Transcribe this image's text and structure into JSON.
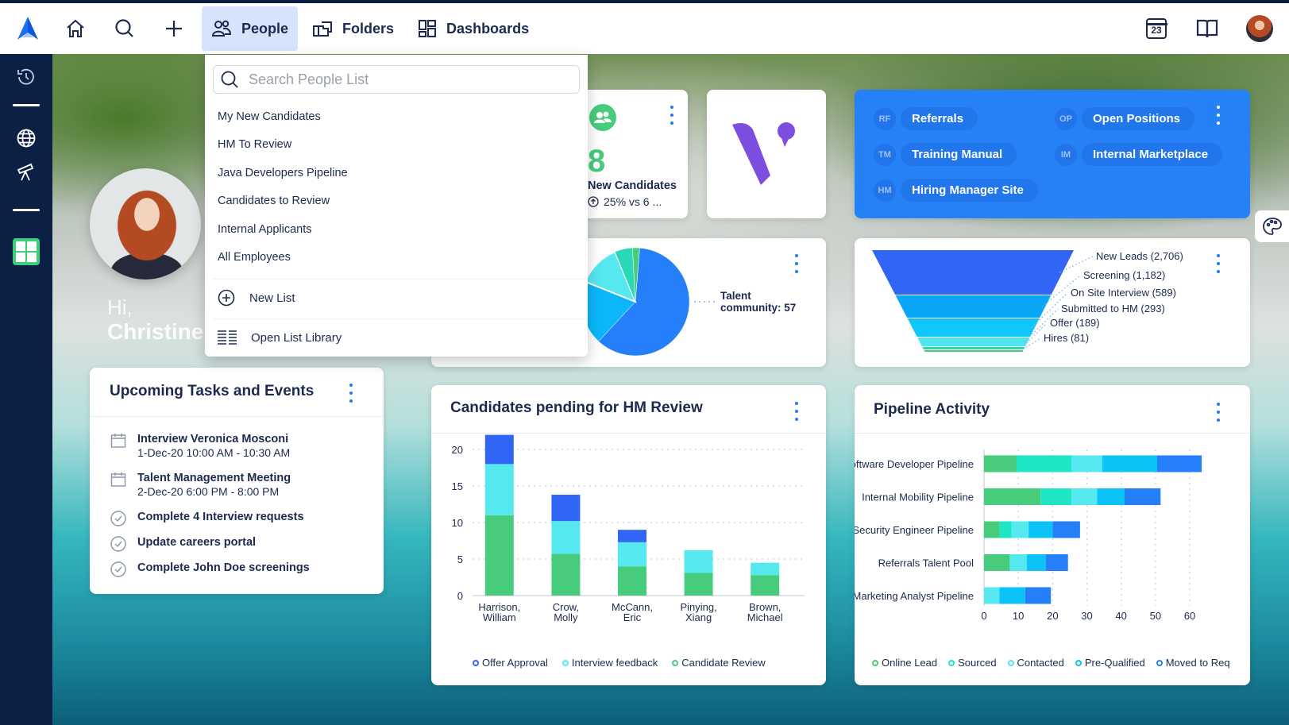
{
  "topnav": {
    "logo": "app-logo",
    "icons": {
      "home": "home-icon",
      "search": "search-icon",
      "create": "plus-icon"
    },
    "tabs": [
      {
        "label": "People",
        "icon": "people-icon",
        "active": true
      },
      {
        "label": "Folders",
        "icon": "folders-icon",
        "active": false
      },
      {
        "label": "Dashboards",
        "icon": "dashboards-icon",
        "active": false
      }
    ],
    "calendar_day": "23",
    "right_icons": [
      "calendar-icon",
      "book-icon",
      "user-avatar"
    ]
  },
  "sidebar": {
    "items": [
      "history-icon",
      "globe-icon",
      "telescope-icon",
      "dashboard-icon"
    ]
  },
  "people_dropdown": {
    "search_placeholder": "Search People List",
    "lists": [
      "My New Candidates",
      "HM To Review",
      "Java Developers Pipeline",
      "Candidates to Review",
      "Internal Applicants",
      "All Employees"
    ],
    "new_list_label": "New List",
    "open_library_label": "Open List Library"
  },
  "greeting": {
    "hi": "Hi,",
    "name": "Christine!"
  },
  "new_candidates_card": {
    "value": "8",
    "label": "New Candidates",
    "trend": "25% vs 6 ..."
  },
  "quick_links": [
    {
      "abbr": "RF",
      "label": "Referrals"
    },
    {
      "abbr": "OP",
      "label": "Open Positions"
    },
    {
      "abbr": "TM",
      "label": "Training Manual"
    },
    {
      "abbr": "IM",
      "label": "Internal Marketplace"
    },
    {
      "abbr": "HM",
      "label": "Hiring Manager Site"
    }
  ],
  "tasks_card": {
    "title": "Upcoming Tasks and Events",
    "items": [
      {
        "type": "event",
        "title": "Interview Veronica Mosconi",
        "time": "1-Dec-20 10:00 AM - 10:30 AM"
      },
      {
        "type": "event",
        "title": "Talent Management Meeting",
        "time": "2-Dec-20 6:00 PM - 8:00 PM"
      },
      {
        "type": "task",
        "title": "Complete 4 Interview requests"
      },
      {
        "type": "task",
        "title": "Update careers portal"
      },
      {
        "type": "task",
        "title": "Complete John Doe screenings"
      }
    ]
  },
  "colors": {
    "accent": "#1e7bf5",
    "quick_links_bg": "#2680f6",
    "green": "#47cc7c",
    "teal": "#1ee6c4",
    "light_cyan": "#55e8ef",
    "cyan": "#0bc3f7",
    "blue": "#247ff9",
    "deep_blue": "#3165f5"
  },
  "chart_data": [
    {
      "type": "pie",
      "title": "",
      "labels": [
        "Talent community",
        "Cyan segment",
        "Light cyan segment",
        "Teal segment",
        "Green segment"
      ],
      "values": [
        57,
        18,
        12,
        5,
        2
      ],
      "colors": [
        "#247ff9",
        "#0bb7f9",
        "#55e8ef",
        "#2ad8b8",
        "#47cc7c"
      ],
      "annotation": "Talent community: 57"
    },
    {
      "type": "funnel",
      "stages": [
        {
          "label": "New Leads (2,706)",
          "name": "New Leads",
          "value": 2706,
          "color": "#3165f5"
        },
        {
          "label": "Screening (1,182)",
          "name": "Screening",
          "value": 1182,
          "color": "#0aa6f6"
        },
        {
          "label": "On Site Interview (589)",
          "name": "On Site Interview",
          "value": 589,
          "color": "#0ec6f7"
        },
        {
          "label": "Submitted to HM (293)",
          "name": "Submitted to HM",
          "value": 293,
          "color": "#4fe6ee"
        },
        {
          "label": "Offer (189)",
          "name": "Offer",
          "value": 189,
          "color": "#2ed8a8"
        },
        {
          "label": "Hires (81)",
          "name": "Hires",
          "value": 81,
          "color": "#47cc7c"
        }
      ]
    },
    {
      "type": "bar",
      "stacked": true,
      "title": "Candidates pending for HM Review",
      "categories": [
        "Harrison, William",
        "Crow, Molly",
        "McCann, Eric",
        "Pinying, Xiang",
        "Brown, Michael"
      ],
      "category_lines": [
        [
          "Harrison,",
          "William"
        ],
        [
          "Crow,",
          "Molly"
        ],
        [
          "McCann,",
          "Eric"
        ],
        [
          "Pinying,",
          "Xiang"
        ],
        [
          "Brown,",
          "Michael"
        ]
      ],
      "series": [
        {
          "name": "Candidate Review",
          "color": "#47cc7c",
          "values": [
            11,
            5.7,
            4,
            3.1,
            2.8
          ]
        },
        {
          "name": "Interview feedback",
          "color": "#55e8ef",
          "values": [
            7,
            4.5,
            3.3,
            3.1,
            1.7
          ]
        },
        {
          "name": "Offer Approval",
          "color": "#3165f5",
          "values": [
            4,
            3.6,
            1.7,
            0,
            0
          ]
        }
      ],
      "legend_order": [
        "Offer Approval",
        "Interview feedback",
        "Candidate Review"
      ],
      "legend_colors": [
        "#3165f5",
        "#55e8ef",
        "#47cc7c"
      ],
      "yticks": [
        0,
        5,
        10,
        15,
        20
      ],
      "ylim": [
        0,
        22
      ],
      "grid": true,
      "legend": "bottom"
    },
    {
      "type": "bar",
      "orientation": "horizontal",
      "stacked": true,
      "title": "Pipeline Activity",
      "categories": [
        "Software Developer Pipeline",
        "Internal Mobility Pipeline",
        "Security Engineer Pipeline",
        "Referrals Talent Pool",
        "Marketing Analyst Pipeline"
      ],
      "series": [
        {
          "name": "Online Lead",
          "color": "#47cc7c",
          "values": [
            9.5,
            16.5,
            4.5,
            7.5,
            0
          ]
        },
        {
          "name": "Sourced",
          "color": "#1ee6c4",
          "values": [
            16,
            9,
            3.5,
            0,
            0
          ]
        },
        {
          "name": "Contacted",
          "color": "#55e8ef",
          "values": [
            9,
            7.5,
            5,
            5,
            4.5
          ]
        },
        {
          "name": "Pre-Qualified",
          "color": "#0bc3f7",
          "values": [
            16,
            8,
            7,
            5.5,
            7.5
          ]
        },
        {
          "name": "Moved to Req",
          "color": "#247ff9",
          "values": [
            13,
            10.5,
            8,
            6.5,
            7.5
          ]
        }
      ],
      "xticks": [
        0,
        10,
        20,
        30,
        40,
        50,
        60
      ],
      "xlim": [
        0,
        63
      ],
      "grid": true,
      "legend": "bottom"
    }
  ]
}
